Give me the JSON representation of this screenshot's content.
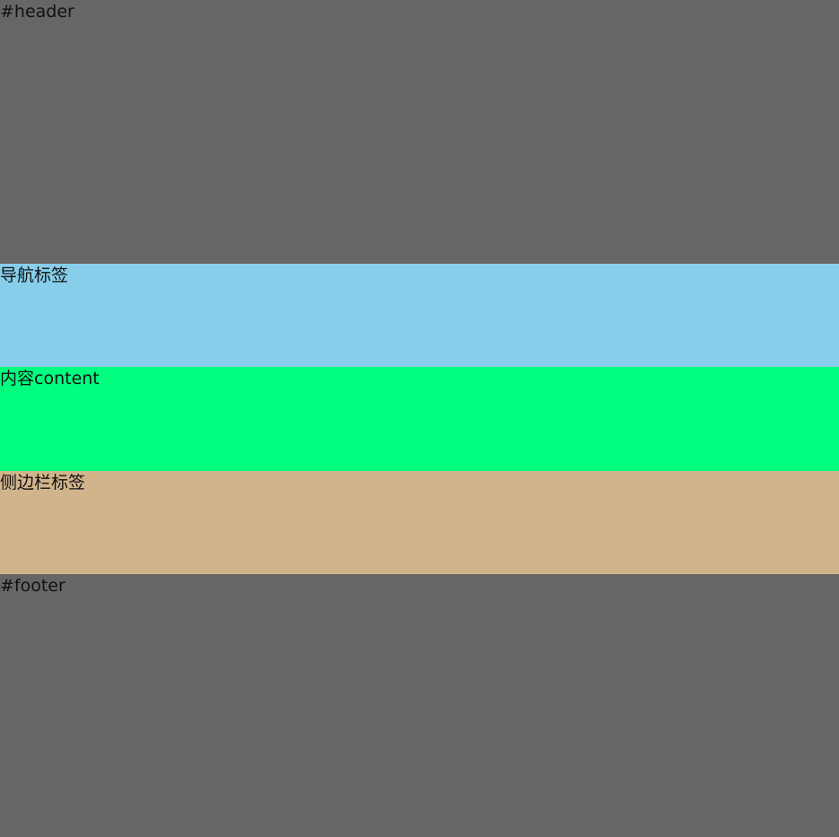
{
  "sections": {
    "header": {
      "label": "#header",
      "color": "#666666"
    },
    "nav": {
      "label": "导航标签",
      "color": "#87ceeb"
    },
    "content": {
      "label": "内容content",
      "color": "#00ff7f"
    },
    "aside": {
      "label": "侧边栏标签",
      "color": "#d2b48c"
    },
    "footer": {
      "label": "#footer",
      "color": "#666666"
    }
  }
}
